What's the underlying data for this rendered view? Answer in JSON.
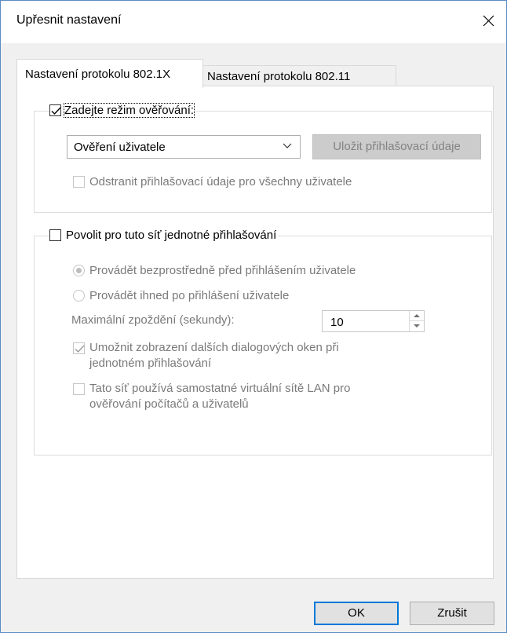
{
  "window": {
    "title": "Upřesnit nastavení"
  },
  "tabs": [
    {
      "label": "Nastavení protokolu 802.1X",
      "active": true
    },
    {
      "label": "Nastavení protokolu 802.11",
      "active": false
    }
  ],
  "auth_group": {
    "checkbox_label": "Zadejte režim ověřování:",
    "checked": true,
    "mode_select_value": "Ověření uživatele",
    "save_credentials_button": "Uložit přihlašovací údaje",
    "delete_credentials_label": "Odstranit přihlašovací údaje pro všechny uživatele"
  },
  "sso_group": {
    "checkbox_label": "Povolit pro tuto síť jednotné přihlašování",
    "checked": false,
    "radio_before_label": "Provádět bezprostředně před přihlášením uživatele",
    "radio_after_label": "Provádět ihned po přihlášení uživatele",
    "max_delay_label": "Maximální zpoždění (sekundy):",
    "max_delay_value": "10",
    "allow_dialogs_label_line1": "Umožnit zobrazení dalších dialogových oken při",
    "allow_dialogs_label_line2": "jednotném přihlašování",
    "separate_vlan_label_line1": "Tato síť používá samostatné virtuální sítě LAN pro",
    "separate_vlan_label_line2": "ověřování počítačů a uživatelů"
  },
  "buttons": {
    "ok": "OK",
    "cancel": "Zrušit"
  },
  "colors": {
    "accent": "#0078d7",
    "disabled_text": "#7a7a7a",
    "window_border": "#5b8bc4"
  }
}
